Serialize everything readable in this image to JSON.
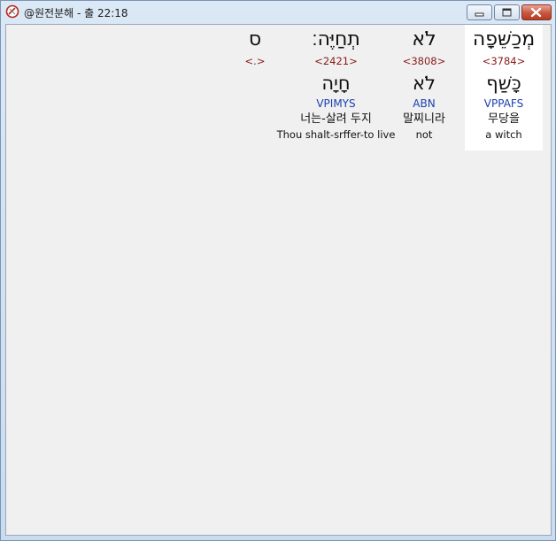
{
  "window": {
    "title": "@원전분해 - 출 22:18",
    "icons": {
      "app": "app-icon",
      "minimize": "minimize-icon",
      "maximize": "maximize-icon",
      "close": "close-icon"
    }
  },
  "words": [
    {
      "hebrew": "מְכַשֵּׁפָה",
      "strong": "<3784>",
      "root": "כָּשַׁף",
      "morph": "VPPAFS",
      "korean": "무당을",
      "english": "a witch"
    },
    {
      "hebrew": "לֹא",
      "strong": "<3808>",
      "root": "לֹא",
      "morph": "ABN",
      "korean": "말찌니라",
      "english": "not"
    },
    {
      "hebrew": "תְחַיֶּה׃",
      "strong": "<2421>",
      "root": "חָיָה",
      "morph": "VPIMYS",
      "korean": "너는-살려 두지",
      "english": "Thou shalt-srffer-to live"
    },
    {
      "hebrew": "ס",
      "strong": "<.>",
      "root": "",
      "morph": "",
      "korean": "",
      "english": ""
    }
  ]
}
